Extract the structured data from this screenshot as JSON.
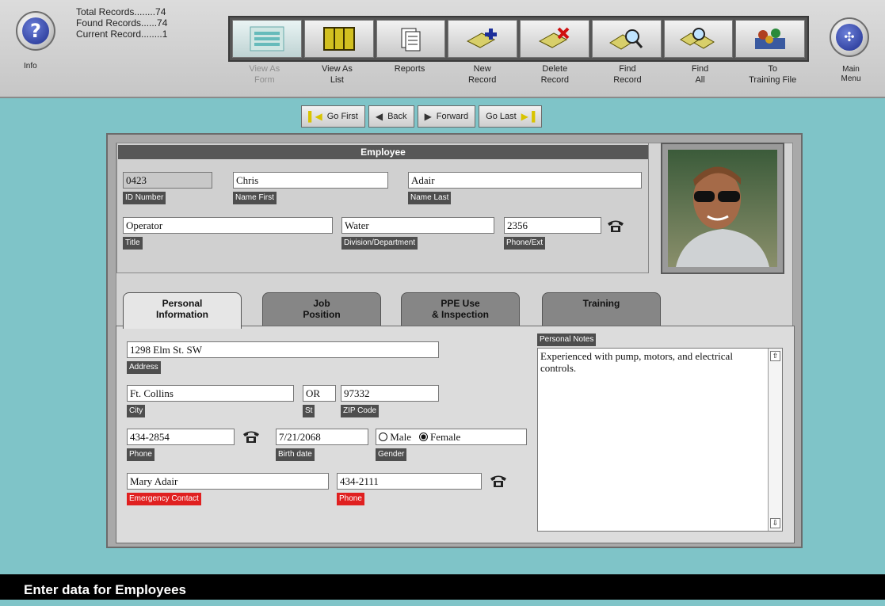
{
  "toolbar": {
    "info_label": "Info",
    "main_menu_label": "Main Menu",
    "stats": {
      "total": "Total Records........74",
      "found": "Found Records......74",
      "current": "Current Record........1"
    },
    "buttons": [
      {
        "label_1": "View As",
        "label_2": "Form",
        "icon": "form-icon"
      },
      {
        "label_1": "View As",
        "label_2": "List",
        "icon": "list-icon"
      },
      {
        "label_1": "Reports",
        "label_2": "",
        "icon": "reports-icon"
      },
      {
        "label_1": "New",
        "label_2": "Record",
        "icon": "new-record-icon"
      },
      {
        "label_1": "Delete",
        "label_2": "Record",
        "icon": "delete-record-icon"
      },
      {
        "label_1": "Find",
        "label_2": "Record",
        "icon": "find-record-icon"
      },
      {
        "label_1": "Find",
        "label_2": "All",
        "icon": "find-all-icon"
      },
      {
        "label_1": "To",
        "label_2": "Training File",
        "icon": "training-file-icon"
      }
    ]
  },
  "nav": {
    "first": "Go First",
    "back": "Back",
    "forward": "Forward",
    "last": "Go Last"
  },
  "employee": {
    "header": "Employee",
    "id_value": "0423",
    "id_label": "ID Number",
    "first_value": "Chris",
    "first_label": "Name First",
    "last_value": "Adair",
    "last_label": "Name Last",
    "title_value": "Operator",
    "title_label": "Title",
    "division_value": "Water",
    "division_label": "Division/Department",
    "phone_value": "2356",
    "phone_label": "Phone/Ext"
  },
  "tabs": [
    {
      "line1": "Personal",
      "line2": "Information"
    },
    {
      "line1": "Job",
      "line2": "Position"
    },
    {
      "line1": "PPE Use",
      "line2": "& Inspection"
    },
    {
      "line1": "Training",
      "line2": ""
    }
  ],
  "personal": {
    "address_value": "1298 Elm St. SW",
    "address_label": "Address",
    "city_value": "Ft. Collins",
    "city_label": "City",
    "state_value": "OR",
    "state_label": "St",
    "zip_value": "97332",
    "zip_label": "ZIP Code",
    "phone_value": "434-2854",
    "phone_label": "Phone",
    "birth_value": "7/21/2068",
    "birth_label": "Birth date",
    "gender_label": "Gender",
    "gender_male": "Male",
    "gender_female": "Female",
    "gender_selected": "Female",
    "emergency_value": "Mary Adair",
    "emergency_label": "Emergency Contact",
    "emergency_phone_value": "434-2111",
    "emergency_phone_label": "Phone",
    "notes_label": "Personal Notes",
    "notes_text": "Experienced with pump, motors, and electrical controls."
  },
  "status_bar": "Enter data for Employees",
  "colors": {
    "background": "#7fc4c8",
    "alert_label": "#e02020",
    "label_bg": "#4e4e4e"
  }
}
